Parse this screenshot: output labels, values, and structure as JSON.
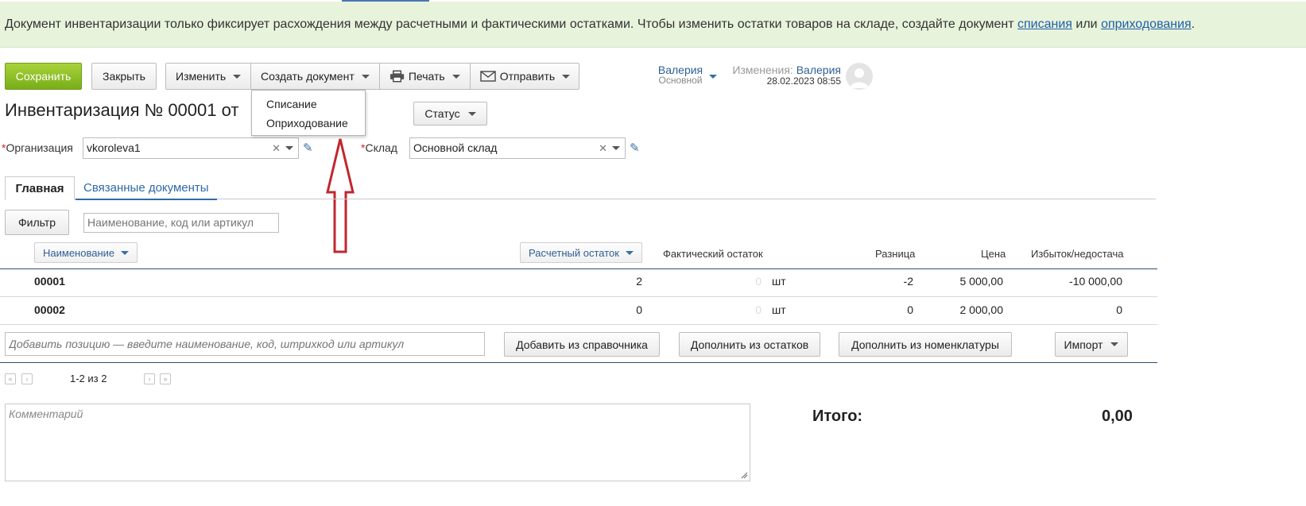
{
  "banner": {
    "text": "Документ инвентаризации только фиксирует расхождения между расчетными и фактическими остатками. Чтобы изменить остатки товаров на складе, создайте документ ",
    "link1": "списания",
    "between": " или ",
    "link2": "оприходования",
    "end": "."
  },
  "toolbar": {
    "save": "Сохранить",
    "close": "Закрыть",
    "change": "Изменить",
    "create": "Создать документ",
    "print": "Печать",
    "send": "Отправить"
  },
  "dropdown": [
    "Списание",
    "Оприходование"
  ],
  "user": {
    "name": "Валерия",
    "role": "Основной",
    "changes_label": "Изменения:",
    "changes_user": "Валерия",
    "changes_date": "28.02.2023 08:55"
  },
  "doc": {
    "title": "Инвентаризация №  00001  от",
    "status": "Статус"
  },
  "fields": {
    "org_label": "Организация",
    "org_value": "vkoroleva1",
    "warehouse_label": "Склад",
    "warehouse_value": "Основной склад"
  },
  "tabs": {
    "main": "Главная",
    "linked": "Связанные документы"
  },
  "filter": {
    "button": "Фильтр",
    "placeholder": "Наименование, код или артикул"
  },
  "columns": {
    "name": "Наименование",
    "calc": "Расчетный остаток",
    "actual": "Фактический остаток",
    "diff": "Разница",
    "price": "Цена",
    "surplus": "Избыток/недостача"
  },
  "rows": [
    {
      "code": "00001",
      "calc": "2",
      "actual": "0",
      "unit": "шт",
      "diff": "-2",
      "price": "5 000,00",
      "surplus": "-10 000,00"
    },
    {
      "code": "00002",
      "calc": "0",
      "actual": "0",
      "unit": "шт",
      "diff": "0",
      "price": "2 000,00",
      "surplus": "0"
    }
  ],
  "add": {
    "placeholder": "Добавить позицию — введите наименование, код, штрихкод или артикул",
    "from_directory": "Добавить из справочника",
    "from_stock": "Дополнить из остатков",
    "from_nomenclature": "Дополнить из номенклатуры",
    "import": "Импорт"
  },
  "pager": {
    "range": "1-2 из 2"
  },
  "comment": {
    "placeholder": "Комментарий"
  },
  "total": {
    "label": "Итого:",
    "value": "0,00"
  },
  "colors": {
    "save_green": "#8cc02a",
    "banner_bg": "#e8f3dc",
    "link": "#1f5fa8",
    "arrow": "#c0272d"
  }
}
